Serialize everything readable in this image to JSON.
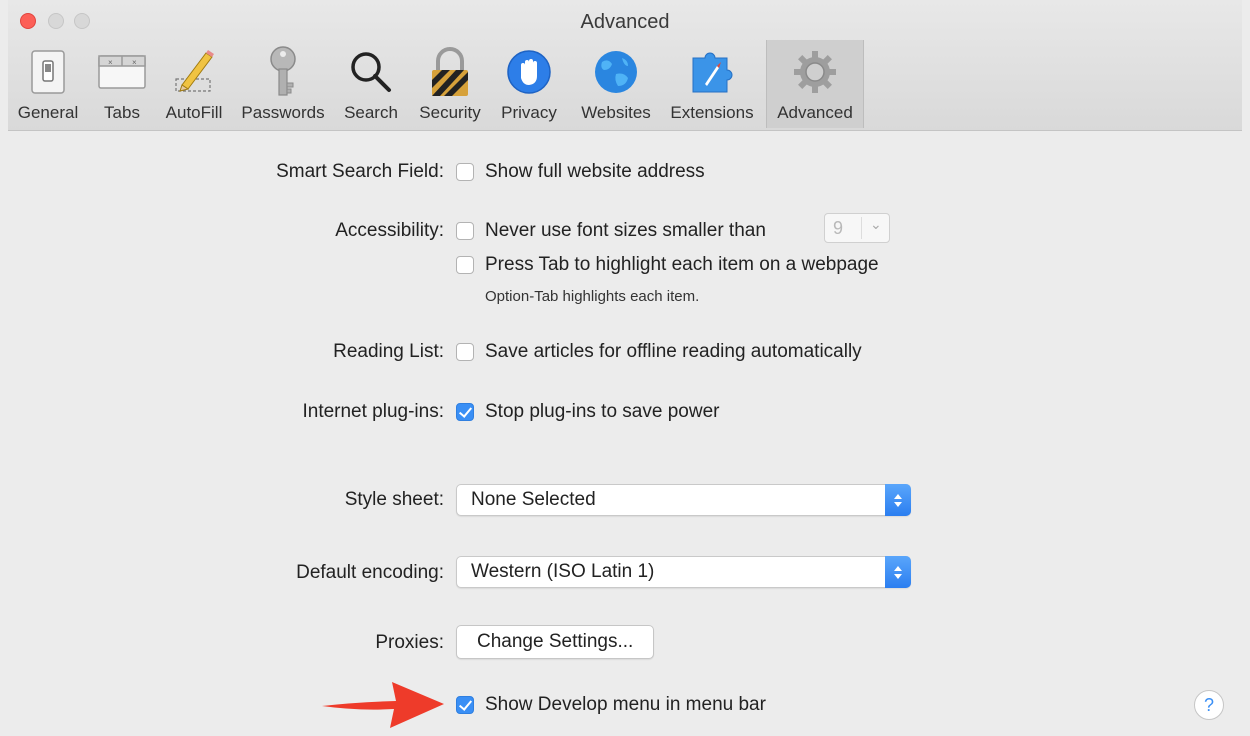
{
  "window": {
    "title": "Advanced"
  },
  "toolbar": {
    "tabs": [
      {
        "label": "General",
        "icon": "switch-icon"
      },
      {
        "label": "Tabs",
        "icon": "tabs-icon"
      },
      {
        "label": "AutoFill",
        "icon": "pencil-icon"
      },
      {
        "label": "Passwords",
        "icon": "key-icon"
      },
      {
        "label": "Search",
        "icon": "magnifier-icon"
      },
      {
        "label": "Security",
        "icon": "lock-icon"
      },
      {
        "label": "Privacy",
        "icon": "hand-icon"
      },
      {
        "label": "Websites",
        "icon": "globe-icon"
      },
      {
        "label": "Extensions",
        "icon": "puzzle-icon"
      },
      {
        "label": "Advanced",
        "icon": "gear-icon",
        "selected": true
      }
    ]
  },
  "settings": {
    "smart_search": {
      "label": "Smart Search Field:",
      "option": "Show full website address",
      "checked": false
    },
    "accessibility": {
      "label": "Accessibility:",
      "font_option": "Never use font sizes smaller than",
      "font_checked": false,
      "font_size": "9",
      "tab_option": "Press Tab to highlight each item on a webpage",
      "tab_checked": false,
      "tab_note": "Option-Tab highlights each item."
    },
    "reading_list": {
      "label": "Reading List:",
      "option": "Save articles for offline reading automatically",
      "checked": false
    },
    "plugins": {
      "label": "Internet plug-ins:",
      "option": "Stop plug-ins to save power",
      "checked": true
    },
    "style_sheet": {
      "label": "Style sheet:",
      "value": "None Selected"
    },
    "encoding": {
      "label": "Default encoding:",
      "value": "Western (ISO Latin 1)"
    },
    "proxies": {
      "label": "Proxies:",
      "button": "Change Settings..."
    },
    "develop": {
      "option": "Show Develop menu in menu bar",
      "checked": true
    }
  },
  "help": {
    "label": "?"
  },
  "colors": {
    "accent": "#3a8ff5",
    "arrow": "#ee3b2a",
    "close": "#fc5f57"
  }
}
